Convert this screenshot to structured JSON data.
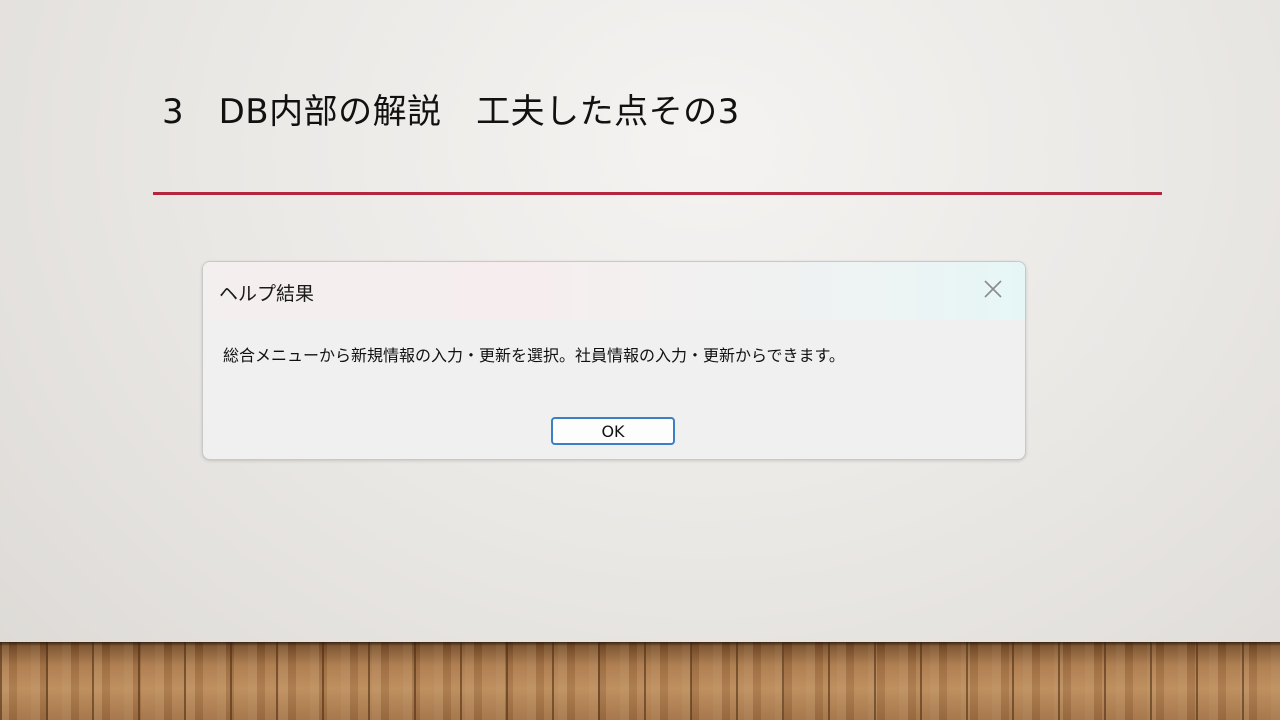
{
  "slide": {
    "title": "3　DB内部の解説　工夫した点その3",
    "rule_color": "#b5253f"
  },
  "dialog": {
    "title": "ヘルプ結果",
    "message": "総合メニューから新規情報の入力・更新を選択。社員情報の入力・更新からできます。",
    "ok_label": "OK",
    "close_icon": "close-icon",
    "button_border_color": "#3b7fc4"
  },
  "background": {
    "floor": "wooden-floor"
  }
}
